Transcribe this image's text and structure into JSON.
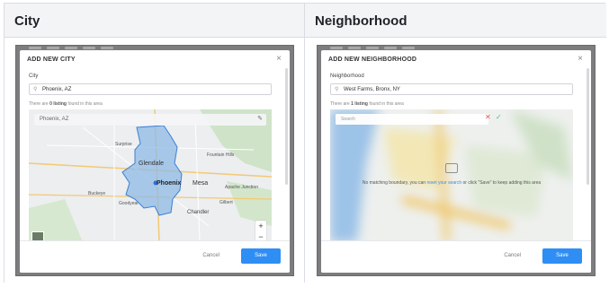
{
  "headers": {
    "left": "City",
    "right": "Neighborhood"
  },
  "city": {
    "title": "ADD NEW CITY",
    "close": "×",
    "field_label": "City",
    "input_value": "Phoenix, AZ",
    "note_prefix": "There are ",
    "note_count": "0 listing",
    "note_suffix": " found in this area",
    "map_search": "Phoenix, AZ",
    "map_labels": [
      "Glendale",
      "Phoenix",
      "Mesa",
      "Chandler",
      "Buckeye",
      "Gilbert",
      "Apache Junction",
      "Fountain Hills",
      "Surprise",
      "Goodyear"
    ],
    "zoom_in": "+",
    "zoom_out": "−",
    "cancel": "Cancel",
    "save": "Save"
  },
  "neighborhood": {
    "title": "ADD NEW NEIGHBORHOOD",
    "close": "×",
    "field_label": "Neighborhood",
    "input_value": "West Farms, Bronx, NY",
    "note_prefix": "There are ",
    "note_count": "1 listing",
    "note_suffix": " found in this area",
    "search_placeholder": "Search",
    "nomatch_prefix": "No matching boundary, you can ",
    "nomatch_link": "reset your search",
    "nomatch_suffix": " or click \"Save\" to keep adding this area",
    "cancel": "Cancel",
    "save": "Save"
  },
  "colors": {
    "accent": "#2f8ef4",
    "boundary": "#6fa8dc",
    "reject": "#e05a5a",
    "accept": "#4bbf73"
  },
  "icons": [
    "search-icon",
    "close-icon",
    "edit-icon",
    "boundary-icon",
    "x-icon",
    "check-icon"
  ]
}
